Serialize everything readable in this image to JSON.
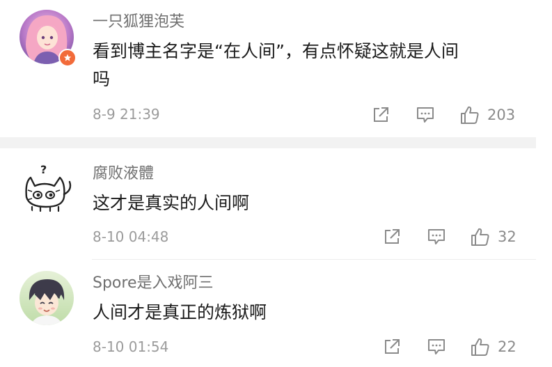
{
  "comments": [
    {
      "username": "一只狐狸泡芙",
      "text_line1": "看到博主名字是“在人间”，有点怀疑这就是人间",
      "text_line2": "吗",
      "timestamp": "8-9 21:39",
      "likes": "203",
      "avatar_icon": "anime-girl-avatar",
      "badge_icon": "vip-star-badge-icon"
    },
    {
      "username": "腐败液體",
      "text": "这才是真实的人间啊",
      "timestamp": "8-10 04:48",
      "likes": "32",
      "avatar_icon": "cartoon-cat-avatar"
    },
    {
      "username": "Spore是入戏阿三",
      "text": "人间才是真正的炼狱啊",
      "timestamp": "8-10 01:54",
      "likes": "22",
      "avatar_icon": "anime-boy-avatar"
    }
  ],
  "actions": {
    "share_icon": "share-icon",
    "reply_icon": "comment-icon",
    "like_icon": "thumbs-up-icon"
  },
  "colors": {
    "username": "#6f6f6f",
    "text": "#1a1a1a",
    "timestamp": "#9b9b9b",
    "icon": "#8a8a8a",
    "badge": "#f26b3a",
    "divider": "#f2f2f2"
  }
}
